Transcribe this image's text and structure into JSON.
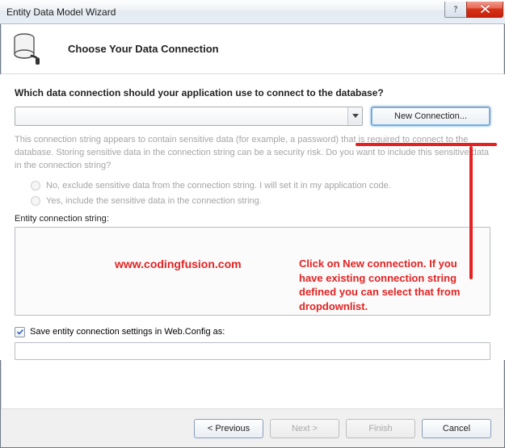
{
  "window": {
    "title": "Entity Data Model Wizard"
  },
  "header": {
    "heading": "Choose Your Data Connection"
  },
  "main": {
    "prompt": "Which data connection should your application use to connect to the database?",
    "connection_value": "",
    "new_connection_label": "New Connection...",
    "sensitive_explain": "This connection string appears to contain sensitive data (for example, a password) that is required to connect to the database. Storing sensitive data in the connection string can be a security risk. Do you want to include this sensitive data in the connection string?",
    "radios": {
      "exclude": "No, exclude sensitive data from the connection string. I will set it in my application code.",
      "include": "Yes, include the sensitive data in the connection string."
    },
    "entity_conn_label": "Entity connection string:",
    "entity_conn_value": "",
    "save_checkbox_checked": true,
    "save_checkbox_label": "Save entity connection settings in Web.Config as:",
    "save_name_value": ""
  },
  "footer": {
    "previous": "< Previous",
    "next": "Next >",
    "finish": "Finish",
    "cancel": "Cancel"
  },
  "annotations": {
    "site": "www.codingfusion.com",
    "tip": "Click on New connection. If you have existing connection string defined you can select that from dropdownlist."
  }
}
